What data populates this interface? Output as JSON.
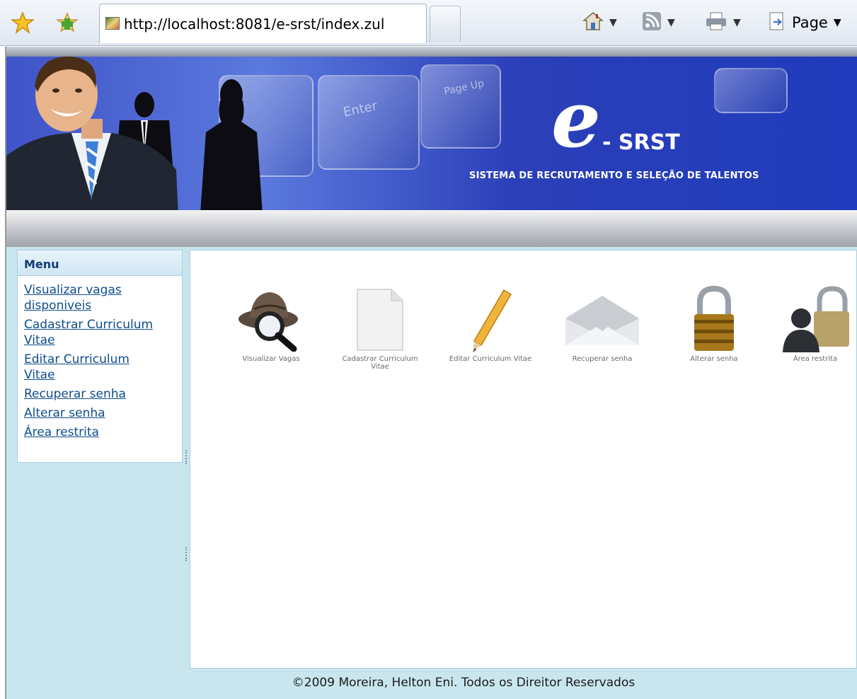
{
  "browser": {
    "url": "http://localhost:8081/e-srst/index.zul",
    "page_menu_label": "Page"
  },
  "banner": {
    "logo_letter": "e",
    "logo_name": "- SRST",
    "tagline": "SISTEMA DE RECRUTAMENTO E SELEÇÃO DE TALENTOS",
    "key_enter": "Enter",
    "key_pageup": "Page Up"
  },
  "menu": {
    "title": "Menu",
    "items": [
      {
        "label": "Visualizar vagas disponiveis"
      },
      {
        "label": "Cadastrar Curriculum Vitae"
      },
      {
        "label": "Editar Curriculum Vitae"
      },
      {
        "label": "Recuperar senha"
      },
      {
        "label": "Alterar senha"
      },
      {
        "label": "Área restrita"
      }
    ]
  },
  "shortcuts": [
    {
      "label": "Visualizar Vagas",
      "icon": "detective-hat-magnifier-icon"
    },
    {
      "label": "Cadastrar Curriculum Vitae",
      "icon": "blank-document-icon"
    },
    {
      "label": "Editar Curriculum Vitae",
      "icon": "pencil-icon"
    },
    {
      "label": "Recuperar senha",
      "icon": "envelope-icon"
    },
    {
      "label": "Alterar senha",
      "icon": "padlock-icon"
    },
    {
      "label": "Área restrita",
      "icon": "user-padlock-icon"
    }
  ],
  "footer": {
    "text": "©2009 Moreira, Helton Eni. Todos os Direitor Reservados"
  },
  "colors": {
    "banner_blue": "#2b3fb8",
    "content_bg": "#c9e6ee",
    "menu_link": "#0e4d8c",
    "menu_title": "#133b72"
  }
}
